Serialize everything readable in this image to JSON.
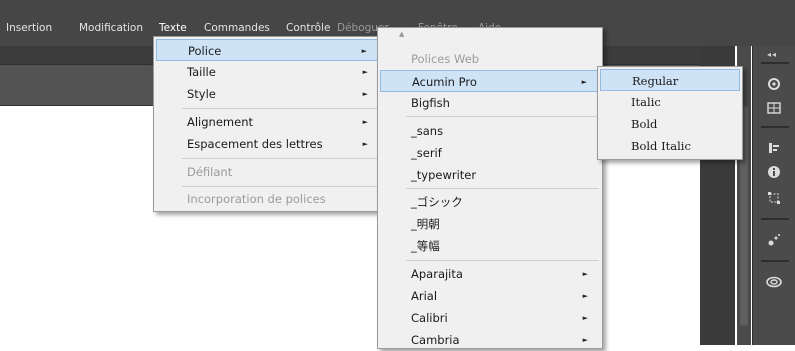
{
  "menubar": {
    "items": [
      "Insertion",
      "Modification",
      "Texte",
      "Commandes",
      "Contrôle",
      "Déboguer",
      "Fenêtre",
      "Aide"
    ]
  },
  "menu_texte": {
    "items": [
      {
        "label": "Police",
        "submenu": true
      },
      {
        "label": "Taille",
        "submenu": true
      },
      {
        "label": "Style",
        "submenu": true
      },
      {
        "label": "Alignement",
        "submenu": true
      },
      {
        "label": "Espacement des lettres",
        "submenu": true
      },
      {
        "label": "Défilant",
        "disabled": true
      },
      {
        "label": "Incorporation de polices",
        "disabled": true
      }
    ]
  },
  "menu_police": {
    "scroll_up": "▲",
    "header": "Polices Web",
    "items": [
      {
        "label": "Acumin Pro",
        "submenu": true
      },
      {
        "label": "Bigfish"
      },
      {
        "label": "_sans"
      },
      {
        "label": "_serif"
      },
      {
        "label": "_typewriter"
      },
      {
        "label": "_ゴシック"
      },
      {
        "label": "_明朝"
      },
      {
        "label": "_等幅"
      },
      {
        "label": "Aparajita",
        "submenu": true
      },
      {
        "label": "Arial",
        "submenu": true
      },
      {
        "label": "Calibri",
        "submenu": true
      },
      {
        "label": "Cambria",
        "submenu": true
      }
    ]
  },
  "menu_acumin": {
    "items": [
      "Regular",
      "Italic",
      "Bold",
      "Bold Italic"
    ]
  },
  "submenu_arrow": "►",
  "panel": {
    "grip": "◂◂",
    "icons": [
      "sync-icon",
      "swatches-icon",
      "align-icon",
      "info-icon",
      "transform-icon",
      "motion-icon",
      "cc-libraries-icon"
    ]
  },
  "colors": {
    "menubar": "#464646",
    "menu_bg": "#f0f0f0",
    "highlight": "#cfe3f7",
    "highlight_border": "#96bbe2",
    "disabled_text": "#9b9b9b"
  }
}
